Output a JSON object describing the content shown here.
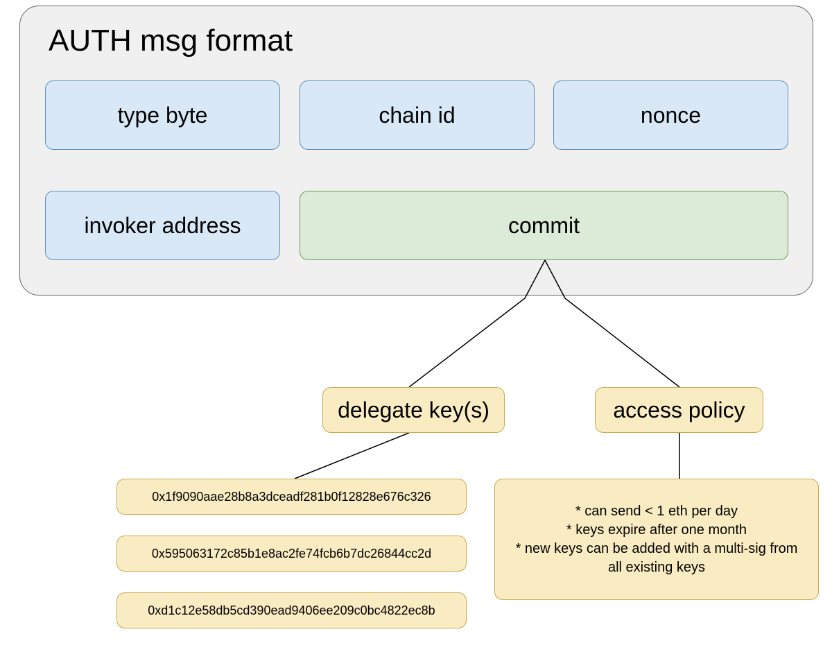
{
  "container": {
    "title": "AUTH msg format"
  },
  "fields": {
    "type_byte": "type byte",
    "chain_id": "chain id",
    "nonce": "nonce",
    "invoker_address": "invoker address",
    "commit": "commit"
  },
  "commit_children": {
    "delegate_keys_label": "delegate key(s)",
    "access_policy_label": "access policy"
  },
  "delegate_keys": [
    "0x1f9090aae28b8a3dceadf281b0f12828e676c326",
    "0x595063172c85b1e8ac2fe74fcb6b7dc26844cc2d",
    "0xd1c12e58db5cd390ead9406ee209c0bc4822ec8b"
  ],
  "access_policy_lines": [
    "* can send < 1 eth per day",
    "* keys expire after one month",
    "* new keys can be added with a multi-sig from",
    "all existing keys"
  ],
  "colors": {
    "container_bg": "#f0f0f0",
    "blue_bg": "#d9e8f7",
    "green_bg": "#dbebd7",
    "yellow_bg": "#faecc2"
  }
}
